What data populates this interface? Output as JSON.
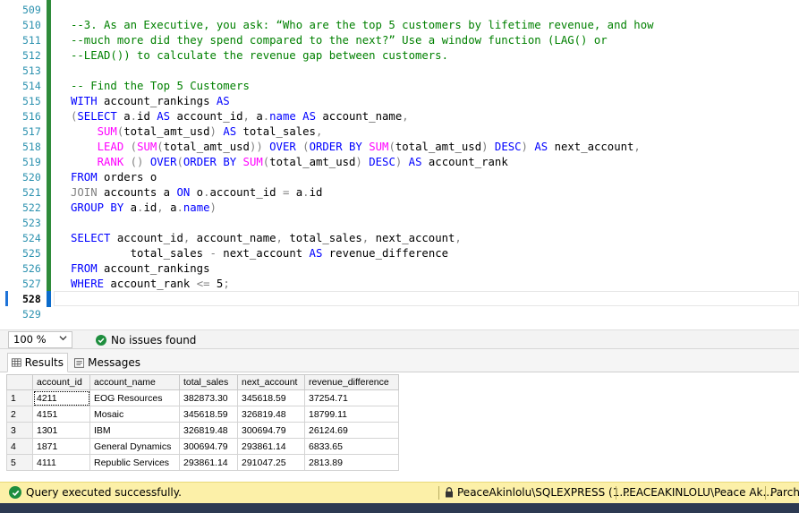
{
  "editor": {
    "line_numbers": [
      "509",
      "510",
      "511",
      "512",
      "513",
      "514",
      "515",
      "516",
      "517",
      "518",
      "519",
      "520",
      "521",
      "522",
      "523",
      "524",
      "525",
      "526",
      "527",
      "528",
      "529"
    ],
    "current_line": "528",
    "lines": [
      {
        "n": "509",
        "tokens": []
      },
      {
        "n": "510",
        "tokens": [
          {
            "t": "--3. As an Executive, you ask: “Who are the top 5 customers by lifetime revenue, and how",
            "c": "cm"
          }
        ]
      },
      {
        "n": "511",
        "tokens": [
          {
            "t": "--much more did they spend compared to the next?” Use a window function (LAG() or",
            "c": "cm"
          }
        ]
      },
      {
        "n": "512",
        "tokens": [
          {
            "t": "--LEAD()) to calculate the revenue gap between customers.",
            "c": "cm"
          }
        ]
      },
      {
        "n": "513",
        "tokens": []
      },
      {
        "n": "514",
        "tokens": [
          {
            "t": "-- Find the Top 5 Customers",
            "c": "cm"
          }
        ]
      },
      {
        "n": "515",
        "tokens": [
          {
            "t": "WITH",
            "c": "kw"
          },
          {
            "t": " account_rankings ",
            "c": "nm"
          },
          {
            "t": "AS",
            "c": "kw"
          }
        ]
      },
      {
        "n": "516",
        "tokens": [
          {
            "t": "(",
            "c": "op"
          },
          {
            "t": "SELECT",
            "c": "kw"
          },
          {
            "t": " a",
            "c": "nm"
          },
          {
            "t": ".",
            "c": "op"
          },
          {
            "t": "id ",
            "c": "nm"
          },
          {
            "t": "AS",
            "c": "kw"
          },
          {
            "t": " account_id",
            "c": "nm"
          },
          {
            "t": ",",
            "c": "op"
          },
          {
            "t": " a",
            "c": "nm"
          },
          {
            "t": ".",
            "c": "op"
          },
          {
            "t": "name",
            "c": "kw"
          },
          {
            "t": " ",
            "c": "nm"
          },
          {
            "t": "AS",
            "c": "kw"
          },
          {
            "t": " account_name",
            "c": "nm"
          },
          {
            "t": ",",
            "c": "op"
          }
        ]
      },
      {
        "n": "517",
        "tokens": [
          {
            "t": "    ",
            "c": "nm"
          },
          {
            "t": "SUM",
            "c": "fn"
          },
          {
            "t": "(",
            "c": "op"
          },
          {
            "t": "total_amt_usd",
            "c": "nm"
          },
          {
            "t": ")",
            "c": "op"
          },
          {
            "t": " ",
            "c": "nm"
          },
          {
            "t": "AS",
            "c": "kw"
          },
          {
            "t": " total_sales",
            "c": "nm"
          },
          {
            "t": ",",
            "c": "op"
          }
        ]
      },
      {
        "n": "518",
        "tokens": [
          {
            "t": "    ",
            "c": "nm"
          },
          {
            "t": "LEAD",
            "c": "fn"
          },
          {
            "t": " (",
            "c": "op"
          },
          {
            "t": "SUM",
            "c": "fn"
          },
          {
            "t": "(",
            "c": "op"
          },
          {
            "t": "total_amt_usd",
            "c": "nm"
          },
          {
            "t": "))",
            "c": "op"
          },
          {
            "t": " ",
            "c": "nm"
          },
          {
            "t": "OVER",
            "c": "kw"
          },
          {
            "t": " (",
            "c": "op"
          },
          {
            "t": "ORDER BY",
            "c": "kw"
          },
          {
            "t": " ",
            "c": "nm"
          },
          {
            "t": "SUM",
            "c": "fn"
          },
          {
            "t": "(",
            "c": "op"
          },
          {
            "t": "total_amt_usd",
            "c": "nm"
          },
          {
            "t": ")",
            "c": "op"
          },
          {
            "t": " ",
            "c": "nm"
          },
          {
            "t": "DESC",
            "c": "kw"
          },
          {
            "t": ")",
            "c": "op"
          },
          {
            "t": " ",
            "c": "nm"
          },
          {
            "t": "AS",
            "c": "kw"
          },
          {
            "t": " next_account",
            "c": "nm"
          },
          {
            "t": ",",
            "c": "op"
          }
        ]
      },
      {
        "n": "519",
        "tokens": [
          {
            "t": "    ",
            "c": "nm"
          },
          {
            "t": "RANK",
            "c": "fn"
          },
          {
            "t": " ()",
            "c": "op"
          },
          {
            "t": " ",
            "c": "nm"
          },
          {
            "t": "OVER",
            "c": "kw"
          },
          {
            "t": "(",
            "c": "op"
          },
          {
            "t": "ORDER BY",
            "c": "kw"
          },
          {
            "t": " ",
            "c": "nm"
          },
          {
            "t": "SUM",
            "c": "fn"
          },
          {
            "t": "(",
            "c": "op"
          },
          {
            "t": "total_amt_usd",
            "c": "nm"
          },
          {
            "t": ")",
            "c": "op"
          },
          {
            "t": " ",
            "c": "nm"
          },
          {
            "t": "DESC",
            "c": "kw"
          },
          {
            "t": ")",
            "c": "op"
          },
          {
            "t": " ",
            "c": "nm"
          },
          {
            "t": "AS",
            "c": "kw"
          },
          {
            "t": " account_rank",
            "c": "nm"
          }
        ]
      },
      {
        "n": "520",
        "tokens": [
          {
            "t": "FROM",
            "c": "kw"
          },
          {
            "t": " orders o",
            "c": "nm"
          }
        ]
      },
      {
        "n": "521",
        "tokens": [
          {
            "t": "JOIN",
            "c": "op"
          },
          {
            "t": " accounts a ",
            "c": "nm"
          },
          {
            "t": "ON",
            "c": "kw"
          },
          {
            "t": " o",
            "c": "nm"
          },
          {
            "t": ".",
            "c": "op"
          },
          {
            "t": "account_id ",
            "c": "nm"
          },
          {
            "t": "=",
            "c": "op"
          },
          {
            "t": " a",
            "c": "nm"
          },
          {
            "t": ".",
            "c": "op"
          },
          {
            "t": "id",
            "c": "nm"
          }
        ]
      },
      {
        "n": "522",
        "tokens": [
          {
            "t": "GROUP BY",
            "c": "kw"
          },
          {
            "t": " a",
            "c": "nm"
          },
          {
            "t": ".",
            "c": "op"
          },
          {
            "t": "id",
            "c": "nm"
          },
          {
            "t": ",",
            "c": "op"
          },
          {
            "t": " a",
            "c": "nm"
          },
          {
            "t": ".",
            "c": "op"
          },
          {
            "t": "name",
            "c": "kw"
          },
          {
            "t": ")",
            "c": "op"
          }
        ]
      },
      {
        "n": "523",
        "tokens": []
      },
      {
        "n": "524",
        "tokens": [
          {
            "t": "SELECT",
            "c": "kw"
          },
          {
            "t": " account_id",
            "c": "nm"
          },
          {
            "t": ",",
            "c": "op"
          },
          {
            "t": " account_name",
            "c": "nm"
          },
          {
            "t": ",",
            "c": "op"
          },
          {
            "t": " total_sales",
            "c": "nm"
          },
          {
            "t": ",",
            "c": "op"
          },
          {
            "t": " next_account",
            "c": "nm"
          },
          {
            "t": ",",
            "c": "op"
          }
        ]
      },
      {
        "n": "525",
        "tokens": [
          {
            "t": "         total_sales ",
            "c": "nm"
          },
          {
            "t": "-",
            "c": "op"
          },
          {
            "t": " next_account ",
            "c": "nm"
          },
          {
            "t": "AS",
            "c": "kw"
          },
          {
            "t": " revenue_difference",
            "c": "nm"
          }
        ]
      },
      {
        "n": "526",
        "tokens": [
          {
            "t": "FROM",
            "c": "kw"
          },
          {
            "t": " account_rankings",
            "c": "nm"
          }
        ]
      },
      {
        "n": "527",
        "tokens": [
          {
            "t": "WHERE",
            "c": "kw"
          },
          {
            "t": " account_rank ",
            "c": "nm"
          },
          {
            "t": "<=",
            "c": "op"
          },
          {
            "t": " 5",
            "c": "nm"
          },
          {
            "t": ";",
            "c": "op"
          }
        ]
      },
      {
        "n": "528",
        "tokens": []
      },
      {
        "n": "529",
        "tokens": []
      }
    ],
    "colors": {
      "comment": "#008000",
      "keyword": "#0000ff",
      "function": "#ff00ff",
      "operator": "#808080",
      "change_bar": "#2e8b3a"
    }
  },
  "editor_status": {
    "zoom": "100 %",
    "issues": "No issues found"
  },
  "results": {
    "tabs": [
      {
        "label": "Results",
        "icon": "grid-icon",
        "active": true
      },
      {
        "label": "Messages",
        "icon": "messages-icon",
        "active": false
      }
    ],
    "columns": [
      "account_id",
      "account_name",
      "total_sales",
      "next_account",
      "revenue_difference"
    ],
    "rows": [
      {
        "n": "1",
        "cells": [
          "4211",
          "EOG Resources",
          "382873.30",
          "345618.59",
          "37254.71"
        ]
      },
      {
        "n": "2",
        "cells": [
          "4151",
          "Mosaic",
          "345618.59",
          "326819.48",
          "18799.11"
        ]
      },
      {
        "n": "3",
        "cells": [
          "1301",
          "IBM",
          "326819.48",
          "300694.79",
          "26124.69"
        ]
      },
      {
        "n": "4",
        "cells": [
          "1871",
          "General Dynamics",
          "300694.79",
          "293861.14",
          "6833.65"
        ]
      },
      {
        "n": "5",
        "cells": [
          "4111",
          "Republic Services",
          "293861.14",
          "291047.25",
          "2813.89"
        ]
      }
    ]
  },
  "status_bar": {
    "message": "Query executed successfully.",
    "server": "PeaceAkinlolu\\SQLEXPRESS (1...",
    "user": "PEACEAKINLOLU\\Peace Ak...",
    "database": "Parch_",
    "background": "#fcf0a8"
  }
}
